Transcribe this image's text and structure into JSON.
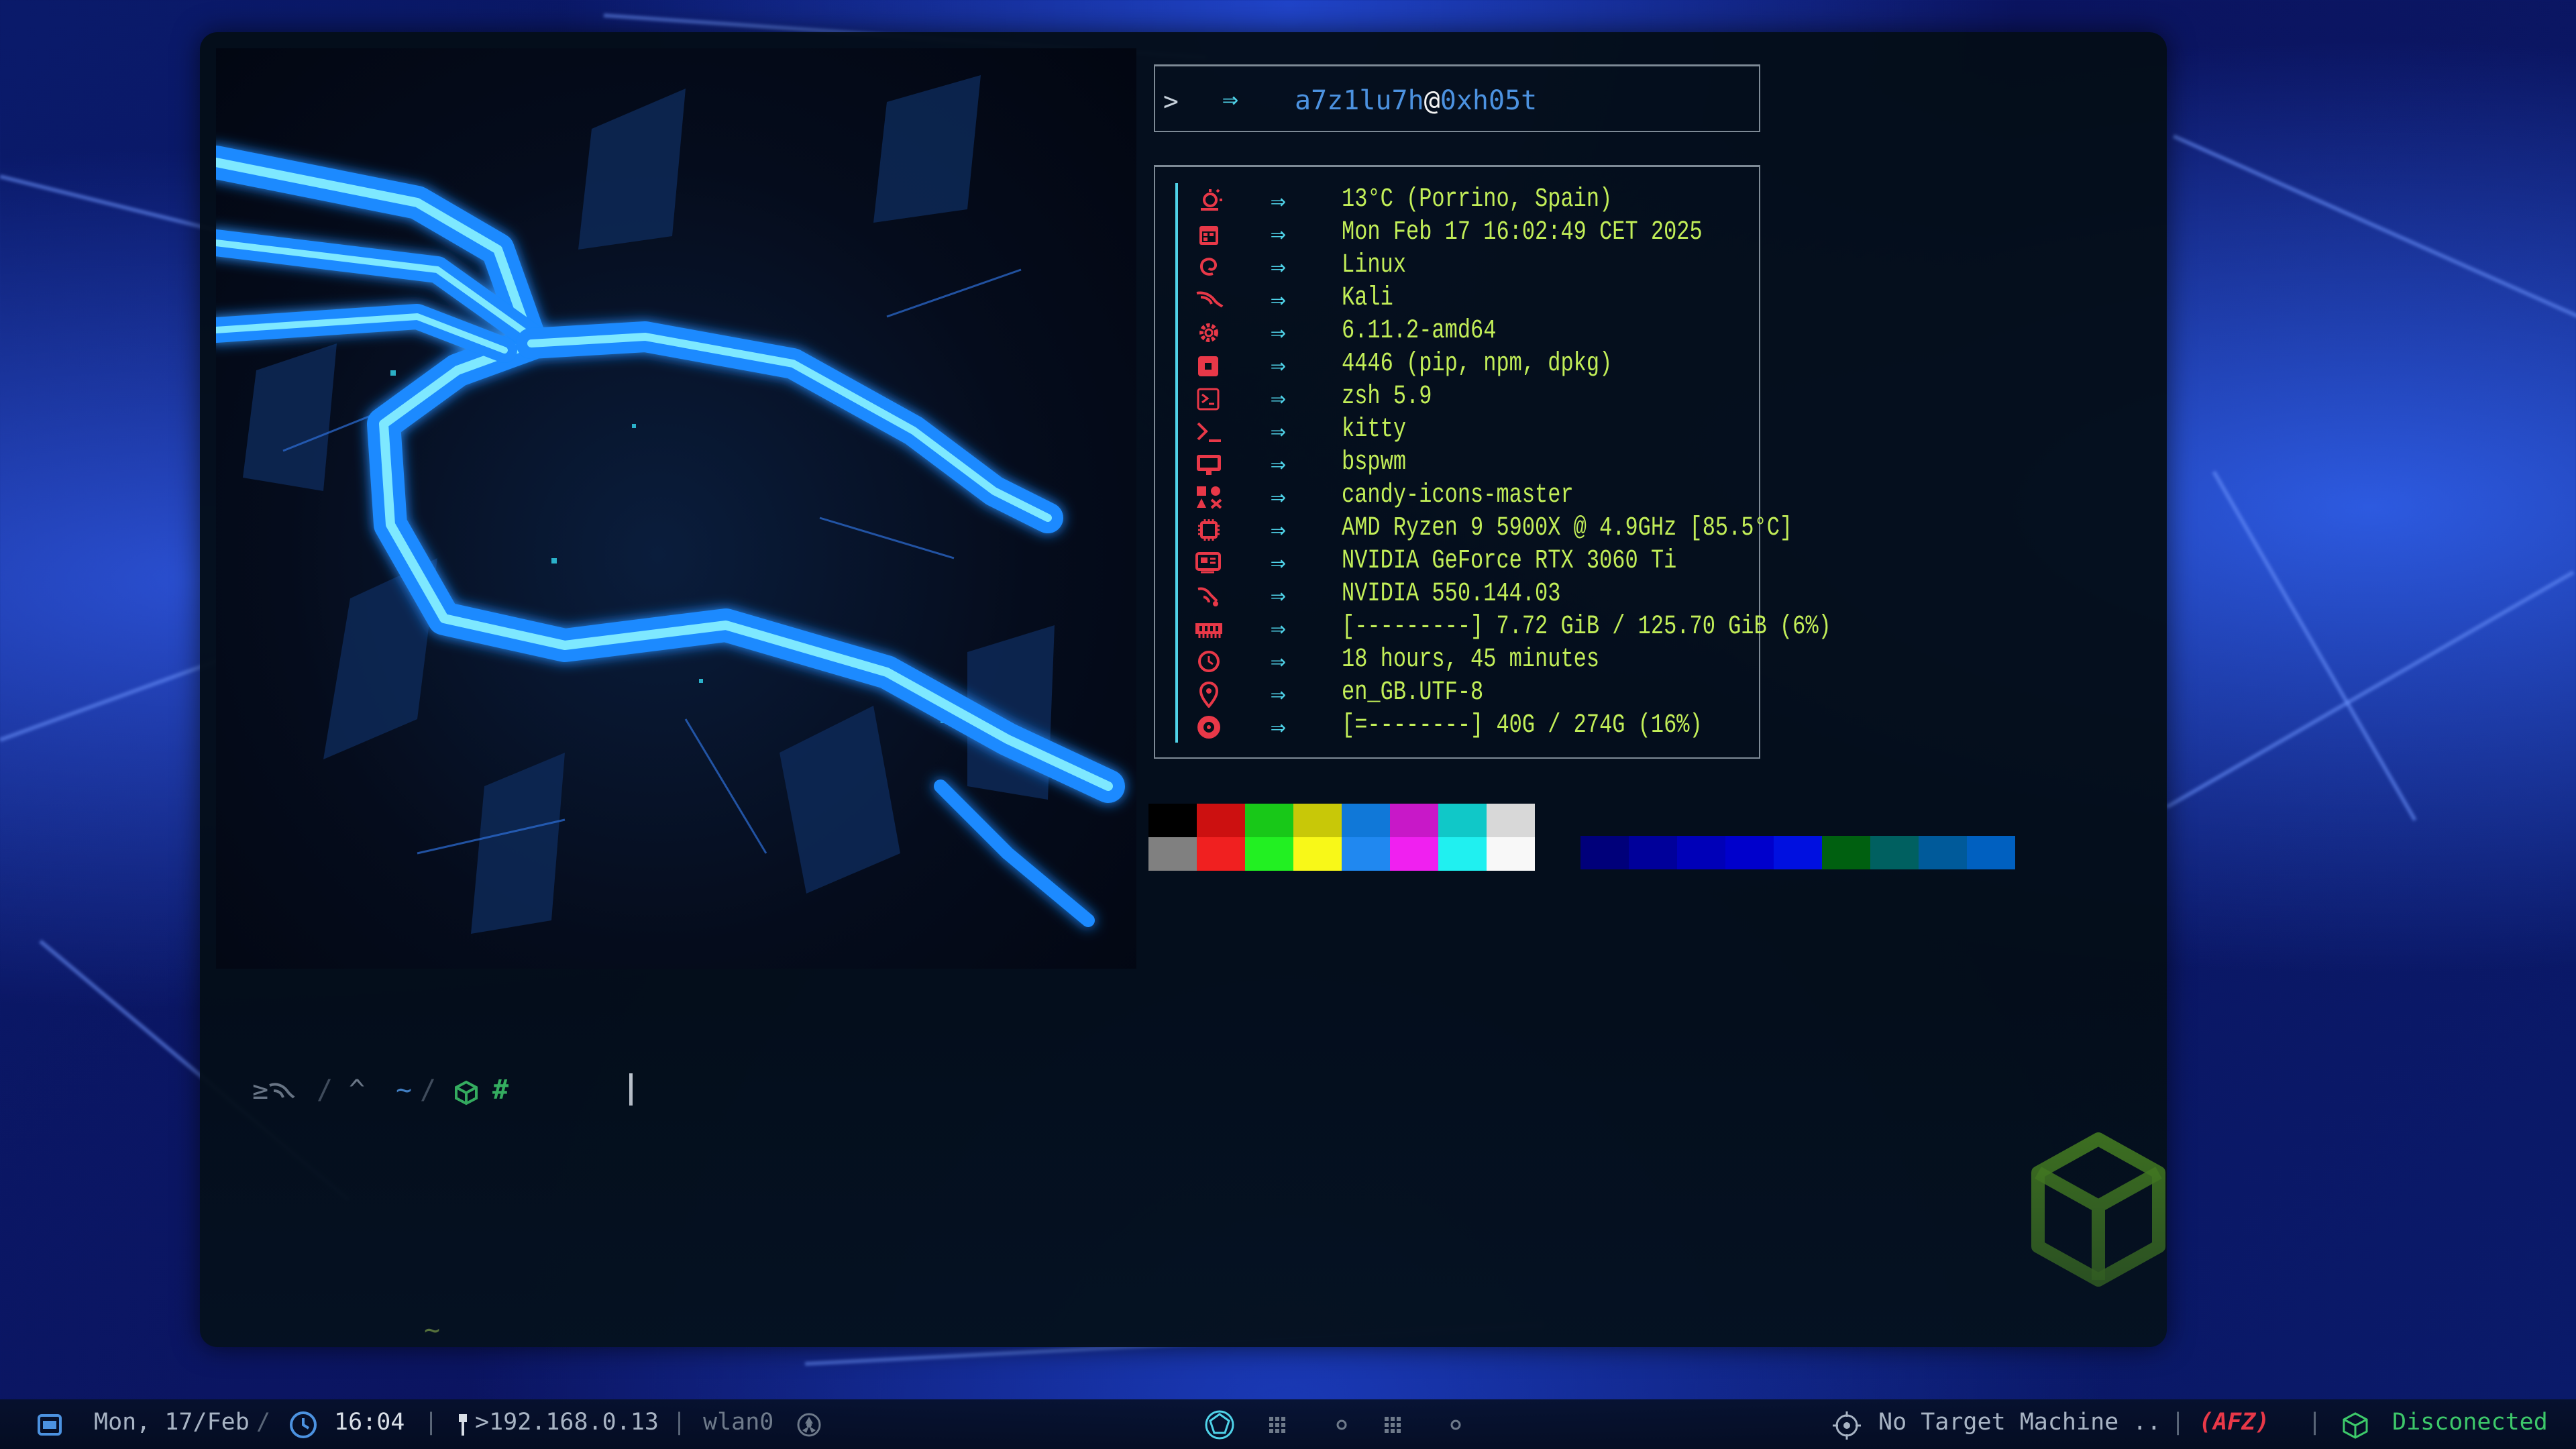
{
  "colors": {
    "accent_cyan": "#4fd2e8",
    "info_text": "#c2ee58",
    "username": "#4c92e0",
    "icon_red": "#e83848",
    "status_green": "#3dc86a"
  },
  "terminal": {
    "header": {
      "prompt": ">",
      "arrow": "⇒",
      "username": "a7z1lu7h",
      "at": "@",
      "hostname": "0xh05t"
    },
    "arrow": "⇒",
    "info": [
      {
        "icon": "weather-icon",
        "value": "13°C (Porrino, Spain)"
      },
      {
        "icon": "calendar-icon",
        "value": "Mon Feb 17 16:02:49 CET 2025"
      },
      {
        "icon": "debian-swirl-icon",
        "value": "Linux"
      },
      {
        "icon": "kali-dragon-icon",
        "value": "Kali"
      },
      {
        "icon": "gear-icon",
        "value": "6.11.2-amd64"
      },
      {
        "icon": "package-icon",
        "value": "4446 (pip, npm, dpkg)"
      },
      {
        "icon": "shell-icon",
        "value": "zsh 5.9"
      },
      {
        "icon": "terminal-icon",
        "value": "kitty"
      },
      {
        "icon": "window-manager-icon",
        "value": "bspwm"
      },
      {
        "icon": "icon-theme-icon",
        "value": "candy-icons-master"
      },
      {
        "icon": "cpu-icon",
        "value": "AMD Ryzen 9 5900X @ 4.9GHz [85.5°C]"
      },
      {
        "icon": "gpu-icon",
        "value": "NVIDIA GeForce RTX 3060 Ti"
      },
      {
        "icon": "driver-icon",
        "value": "NVIDIA 550.144.03"
      },
      {
        "icon": "memory-icon",
        "value": "[---------] 7.72 GiB / 125.70 GiB (6%)"
      },
      {
        "icon": "clock-icon",
        "value": "18 hours, 45 minutes"
      },
      {
        "icon": "location-pin-icon",
        "value": "en_GB.UTF-8"
      },
      {
        "icon": "disk-icon",
        "value": "[=--------] 40G / 274G (16%)"
      }
    ],
    "palette_normal": [
      "#000000",
      "#cc1010",
      "#18c818",
      "#c8c808",
      "#1078d8",
      "#c818c8",
      "#10c8c8",
      "#d8d8d8"
    ],
    "palette_bright": [
      "#808080",
      "#f02020",
      "#22f022",
      "#f8f818",
      "#2088f0",
      "#f020f0",
      "#20f0f0",
      "#f8f8f8"
    ],
    "palette_extra": [
      "#00007a",
      "#00009a",
      "#0000b8",
      "#0000cc",
      "#0010e0",
      "#006010",
      "#006060",
      "#005a9a",
      "#0060c0"
    ],
    "prompt": {
      "segment1": "≥",
      "sep": "/",
      "segment2": "^",
      "segment3": "~",
      "hash": "#",
      "tilde": "~"
    }
  },
  "taskbar": {
    "date": "Mon, 17/Feb",
    "time": "16:04",
    "ip": ">192.168.0.13",
    "interface": "wlan0",
    "target": "No Target Machine ..",
    "vpn": "(AFZ)",
    "status": "Disconected"
  }
}
